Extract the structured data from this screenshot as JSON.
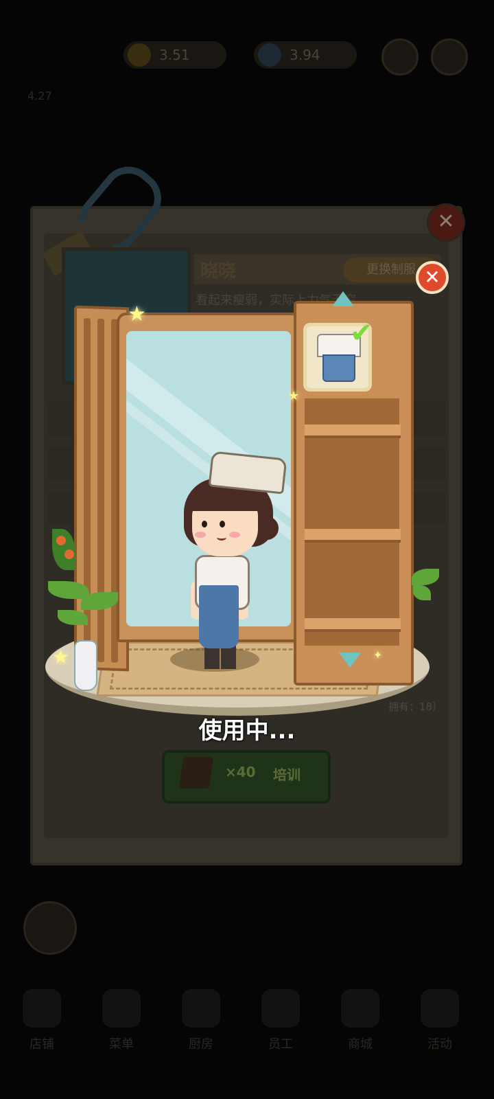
{
  "topbar": {
    "resource1": "3.51",
    "resource2": "3.94",
    "subtext": "4.27"
  },
  "panel": {
    "name": "晓晓",
    "change_uniform": "更换制服",
    "description": "看起来瘦弱，实际上力气无穷",
    "train_cost": "×40",
    "train_label": "培训",
    "owned": "拥有：18）"
  },
  "wardrobe": {
    "status": "使用中..."
  },
  "bottom_nav": [
    {
      "label": "店铺"
    },
    {
      "label": "菜单"
    },
    {
      "label": "厨房"
    },
    {
      "label": "员工"
    },
    {
      "label": "商城"
    },
    {
      "label": "活动"
    }
  ],
  "colors": {
    "close_red": "#e04a2c",
    "check_green": "#7ddb3a",
    "mirror": "#b9dfe0",
    "wood": "#c98f56"
  }
}
